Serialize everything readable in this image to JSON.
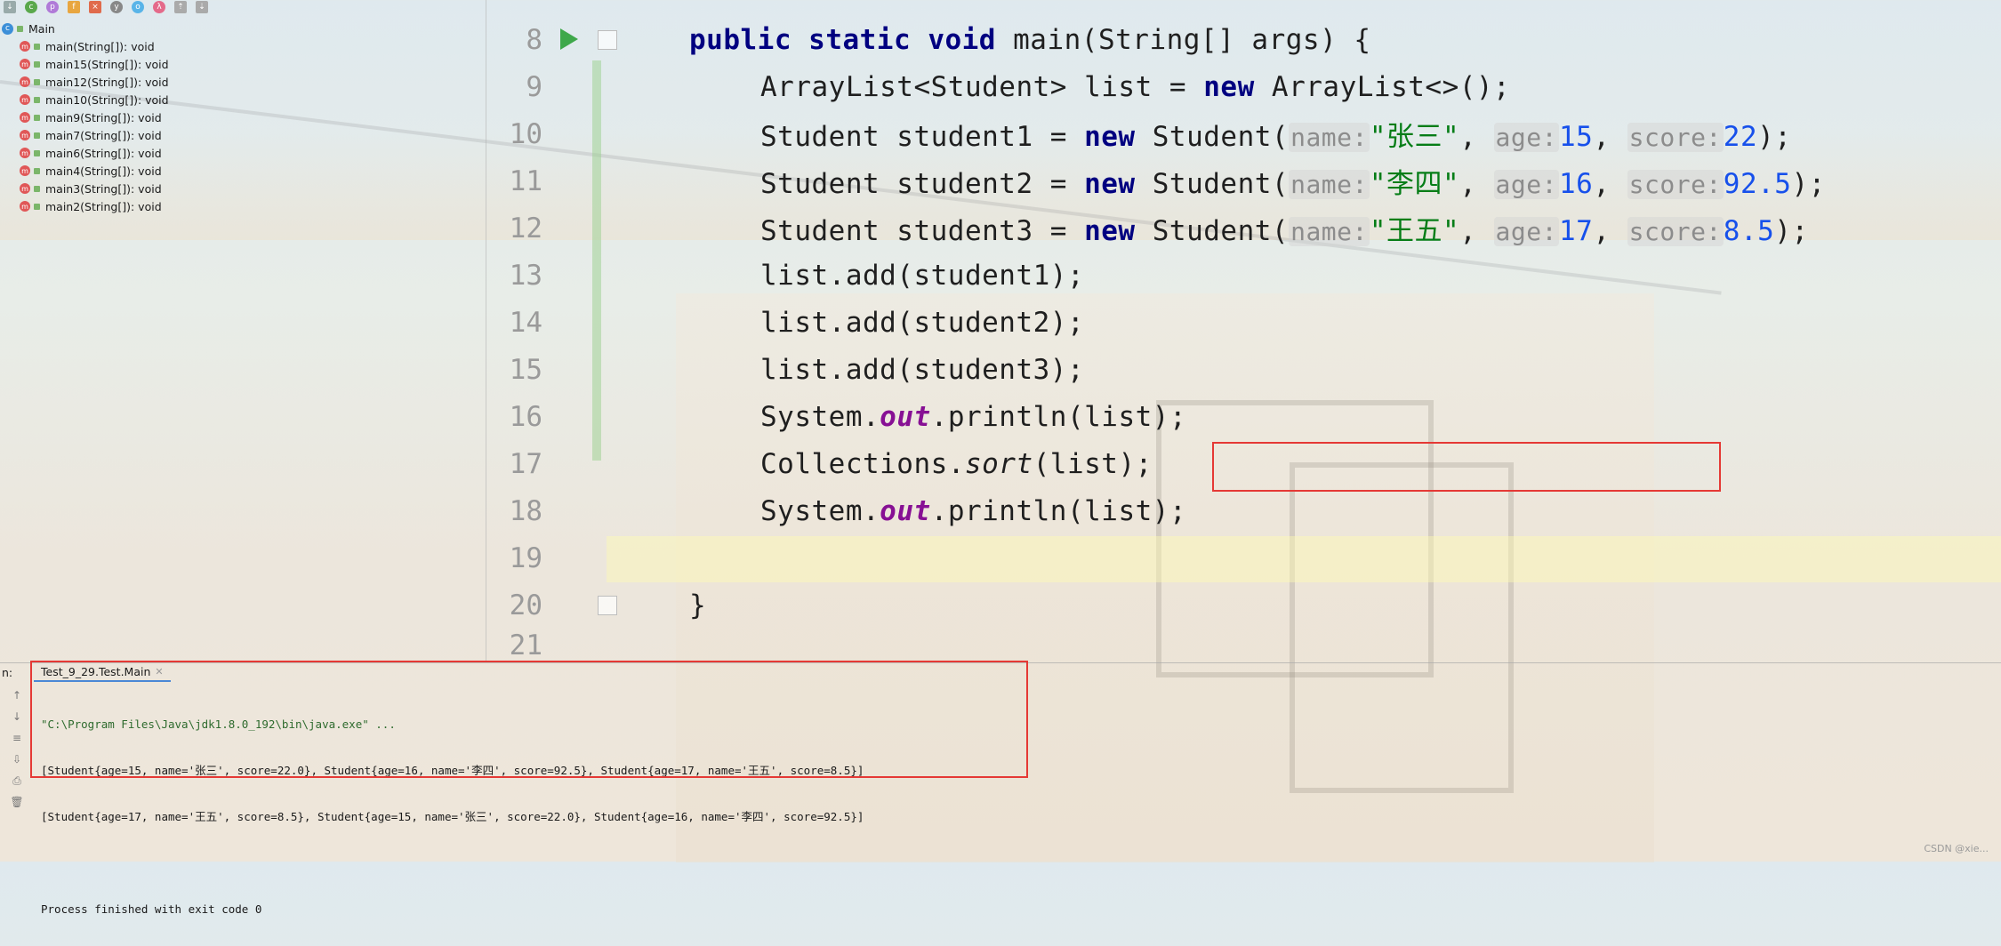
{
  "structure": {
    "root": "Main",
    "methods": [
      "main(String[]): void",
      "main15(String[]): void",
      "main12(String[]): void",
      "main10(String[]): void",
      "main9(String[]): void",
      "main7(String[]): void",
      "main6(String[]): void",
      "main4(String[]): void",
      "main3(String[]): void",
      "main2(String[]): void"
    ]
  },
  "editor": {
    "line_numbers": [
      "8",
      "9",
      "10",
      "11",
      "12",
      "13",
      "14",
      "15",
      "16",
      "17",
      "18",
      "19",
      "20",
      "21"
    ],
    "line8": {
      "kw1": "public",
      "kw2": "static",
      "kw3": "void",
      "rest": " main(String[] args) {"
    },
    "line9": {
      "pre": "ArrayList<Student> list = ",
      "kw": "new",
      "post": " ArrayList<>();"
    },
    "line10": {
      "pre": "Student student1 = ",
      "kw": "new",
      "mid": " Student(",
      "h1": "name:",
      "s": "\"张三\"",
      "c1": ", ",
      "h2": "age:",
      "n1": "15",
      "c2": ", ",
      "h3": "score:",
      "n2": "22",
      "end": ");"
    },
    "line11": {
      "pre": "Student student2 = ",
      "kw": "new",
      "mid": " Student(",
      "h1": "name:",
      "s": "\"李四\"",
      "c1": ", ",
      "h2": "age:",
      "n1": "16",
      "c2": ", ",
      "h3": "score:",
      "n2": "92.5",
      "end": ");"
    },
    "line12": {
      "pre": "Student student3 = ",
      "kw": "new",
      "mid": " Student(",
      "h1": "name:",
      "s": "\"王五\"",
      "c1": ", ",
      "h2": "age:",
      "n1": "17",
      "c2": ", ",
      "h3": "score:",
      "n2": "8.5",
      "end": ");"
    },
    "line13": "list.add(student1);",
    "line14": "list.add(student2);",
    "line15": "list.add(student3);",
    "line16": {
      "pre": "System.",
      "fld": "out",
      "post": ".println(list);"
    },
    "line17": {
      "pre": "Collections.",
      "it": "sort",
      "post": "(list);"
    },
    "line18": {
      "pre": "System.",
      "fld": "out",
      "post": ".println(list);"
    },
    "line20": "}"
  },
  "run": {
    "label": "n:",
    "tab": "Test_9_29.Test.Main",
    "console": [
      "\"C:\\Program Files\\Java\\jdk1.8.0_192\\bin\\java.exe\" ...",
      "[Student{age=15, name='张三', score=22.0}, Student{age=16, name='李四', score=92.5}, Student{age=17, name='王五', score=8.5}]",
      "[Student{age=17, name='王五', score=8.5}, Student{age=15, name='张三', score=22.0}, Student{age=16, name='李四', score=92.5}]",
      "",
      "Process finished with exit code 0"
    ]
  },
  "watermark": "CSDN @xie...",
  "colors": {
    "keyword": "#000080",
    "string": "#067d17",
    "number": "#1750eb",
    "field": "#871094",
    "highlight_box": "#e53935"
  }
}
